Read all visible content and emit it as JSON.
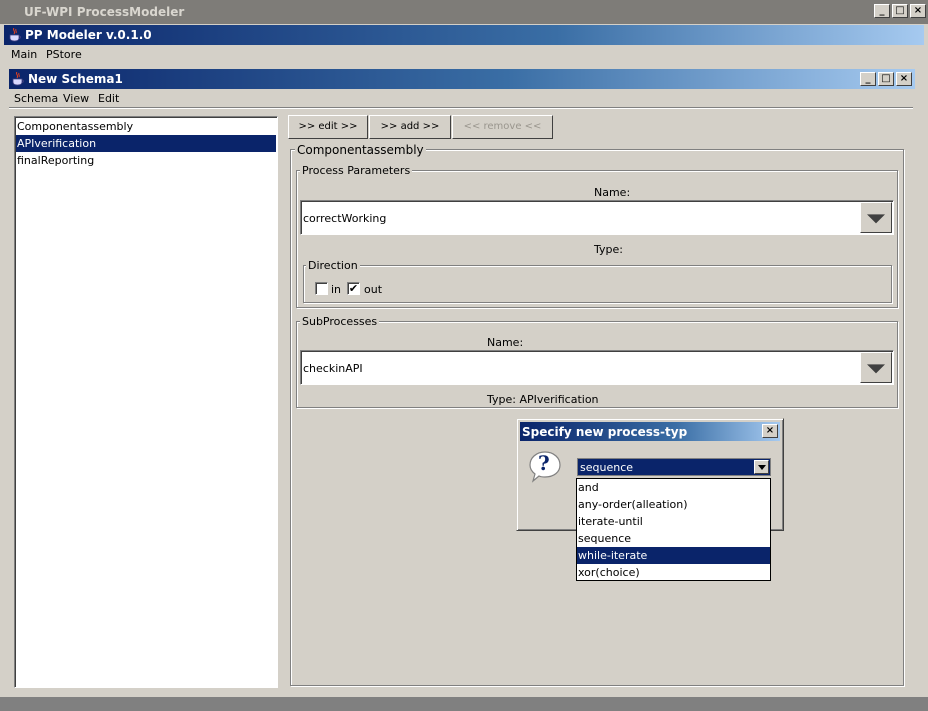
{
  "outer_window": {
    "title": "UF-WPI ProcessModeler",
    "controls": [
      "_",
      "□",
      "×"
    ]
  },
  "app_window": {
    "title": "PP Modeler v.0.1.0"
  },
  "main_menu": [
    "Main",
    "PStore"
  ],
  "schema_window": {
    "title": "New Schema1",
    "controls": [
      "_",
      "□",
      "×"
    ],
    "menu": [
      "Schema",
      "View",
      "Edit"
    ]
  },
  "process_list": {
    "items": [
      "Componentassembly",
      "APIverification",
      "finalReporting"
    ],
    "selected_index": 1
  },
  "toolbar": {
    "edit_label": ">> edit >>",
    "add_label": ">> add >>",
    "remove_label": "<< remove <<"
  },
  "detail": {
    "group_title": "Componentassembly",
    "process_parameters": {
      "title": "Process Parameters",
      "name_label": "Name:",
      "name_value": "correctWorking",
      "type_label": "Type:",
      "direction": {
        "title": "Direction",
        "in_label": "in",
        "in_checked": false,
        "out_label": "out",
        "out_checked": true,
        "check_mark": "✔"
      }
    },
    "subprocesses": {
      "title": "SubProcesses",
      "name_label": "Name:",
      "name_value": "checkinAPI",
      "type_label": "Type: APIverification"
    }
  },
  "dialog": {
    "title": "Specify new process-typ",
    "close_label": "×",
    "icon_glyph": "?",
    "selected_value": "sequence",
    "options": [
      "and",
      "any-order(alleation)",
      "iterate-until",
      "sequence",
      "while-iterate",
      "xor(choice)"
    ],
    "highlighted_index": 4
  },
  "colors": {
    "selection": "#0a246a",
    "window_bg": "#d4d0c8",
    "title_gradient_start": "#0a246a",
    "title_gradient_end": "#a6caf0"
  }
}
